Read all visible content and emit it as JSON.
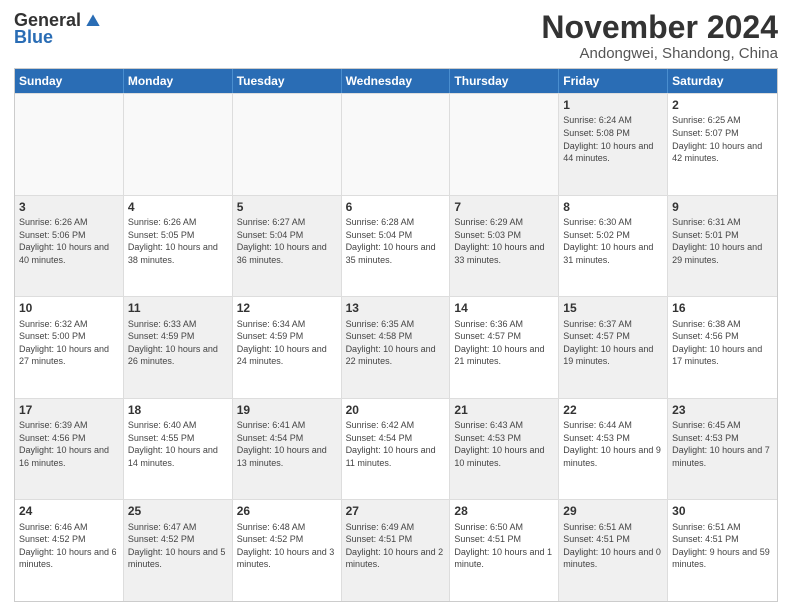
{
  "header": {
    "logo_general": "General",
    "logo_blue": "Blue",
    "month_year": "November 2024",
    "location": "Andongwei, Shandong, China"
  },
  "calendar": {
    "days": [
      "Sunday",
      "Monday",
      "Tuesday",
      "Wednesday",
      "Thursday",
      "Friday",
      "Saturday"
    ],
    "rows": [
      [
        {
          "day": "",
          "detail": "",
          "empty": true
        },
        {
          "day": "",
          "detail": "",
          "empty": true
        },
        {
          "day": "",
          "detail": "",
          "empty": true
        },
        {
          "day": "",
          "detail": "",
          "empty": true
        },
        {
          "day": "",
          "detail": "",
          "empty": true
        },
        {
          "day": "1",
          "detail": "Sunrise: 6:24 AM\nSunset: 5:08 PM\nDaylight: 10 hours and 44 minutes.",
          "shaded": true
        },
        {
          "day": "2",
          "detail": "Sunrise: 6:25 AM\nSunset: 5:07 PM\nDaylight: 10 hours and 42 minutes.",
          "shaded": false
        }
      ],
      [
        {
          "day": "3",
          "detail": "Sunrise: 6:26 AM\nSunset: 5:06 PM\nDaylight: 10 hours and 40 minutes.",
          "shaded": true
        },
        {
          "day": "4",
          "detail": "Sunrise: 6:26 AM\nSunset: 5:05 PM\nDaylight: 10 hours and 38 minutes.",
          "shaded": false
        },
        {
          "day": "5",
          "detail": "Sunrise: 6:27 AM\nSunset: 5:04 PM\nDaylight: 10 hours and 36 minutes.",
          "shaded": true
        },
        {
          "day": "6",
          "detail": "Sunrise: 6:28 AM\nSunset: 5:04 PM\nDaylight: 10 hours and 35 minutes.",
          "shaded": false
        },
        {
          "day": "7",
          "detail": "Sunrise: 6:29 AM\nSunset: 5:03 PM\nDaylight: 10 hours and 33 minutes.",
          "shaded": true
        },
        {
          "day": "8",
          "detail": "Sunrise: 6:30 AM\nSunset: 5:02 PM\nDaylight: 10 hours and 31 minutes.",
          "shaded": false
        },
        {
          "day": "9",
          "detail": "Sunrise: 6:31 AM\nSunset: 5:01 PM\nDaylight: 10 hours and 29 minutes.",
          "shaded": true
        }
      ],
      [
        {
          "day": "10",
          "detail": "Sunrise: 6:32 AM\nSunset: 5:00 PM\nDaylight: 10 hours and 27 minutes.",
          "shaded": false
        },
        {
          "day": "11",
          "detail": "Sunrise: 6:33 AM\nSunset: 4:59 PM\nDaylight: 10 hours and 26 minutes.",
          "shaded": true
        },
        {
          "day": "12",
          "detail": "Sunrise: 6:34 AM\nSunset: 4:59 PM\nDaylight: 10 hours and 24 minutes.",
          "shaded": false
        },
        {
          "day": "13",
          "detail": "Sunrise: 6:35 AM\nSunset: 4:58 PM\nDaylight: 10 hours and 22 minutes.",
          "shaded": true
        },
        {
          "day": "14",
          "detail": "Sunrise: 6:36 AM\nSunset: 4:57 PM\nDaylight: 10 hours and 21 minutes.",
          "shaded": false
        },
        {
          "day": "15",
          "detail": "Sunrise: 6:37 AM\nSunset: 4:57 PM\nDaylight: 10 hours and 19 minutes.",
          "shaded": true
        },
        {
          "day": "16",
          "detail": "Sunrise: 6:38 AM\nSunset: 4:56 PM\nDaylight: 10 hours and 17 minutes.",
          "shaded": false
        }
      ],
      [
        {
          "day": "17",
          "detail": "Sunrise: 6:39 AM\nSunset: 4:56 PM\nDaylight: 10 hours and 16 minutes.",
          "shaded": true
        },
        {
          "day": "18",
          "detail": "Sunrise: 6:40 AM\nSunset: 4:55 PM\nDaylight: 10 hours and 14 minutes.",
          "shaded": false
        },
        {
          "day": "19",
          "detail": "Sunrise: 6:41 AM\nSunset: 4:54 PM\nDaylight: 10 hours and 13 minutes.",
          "shaded": true
        },
        {
          "day": "20",
          "detail": "Sunrise: 6:42 AM\nSunset: 4:54 PM\nDaylight: 10 hours and 11 minutes.",
          "shaded": false
        },
        {
          "day": "21",
          "detail": "Sunrise: 6:43 AM\nSunset: 4:53 PM\nDaylight: 10 hours and 10 minutes.",
          "shaded": true
        },
        {
          "day": "22",
          "detail": "Sunrise: 6:44 AM\nSunset: 4:53 PM\nDaylight: 10 hours and 9 minutes.",
          "shaded": false
        },
        {
          "day": "23",
          "detail": "Sunrise: 6:45 AM\nSunset: 4:53 PM\nDaylight: 10 hours and 7 minutes.",
          "shaded": true
        }
      ],
      [
        {
          "day": "24",
          "detail": "Sunrise: 6:46 AM\nSunset: 4:52 PM\nDaylight: 10 hours and 6 minutes.",
          "shaded": false
        },
        {
          "day": "25",
          "detail": "Sunrise: 6:47 AM\nSunset: 4:52 PM\nDaylight: 10 hours and 5 minutes.",
          "shaded": true
        },
        {
          "day": "26",
          "detail": "Sunrise: 6:48 AM\nSunset: 4:52 PM\nDaylight: 10 hours and 3 minutes.",
          "shaded": false
        },
        {
          "day": "27",
          "detail": "Sunrise: 6:49 AM\nSunset: 4:51 PM\nDaylight: 10 hours and 2 minutes.",
          "shaded": true
        },
        {
          "day": "28",
          "detail": "Sunrise: 6:50 AM\nSunset: 4:51 PM\nDaylight: 10 hours and 1 minute.",
          "shaded": false
        },
        {
          "day": "29",
          "detail": "Sunrise: 6:51 AM\nSunset: 4:51 PM\nDaylight: 10 hours and 0 minutes.",
          "shaded": true
        },
        {
          "day": "30",
          "detail": "Sunrise: 6:51 AM\nSunset: 4:51 PM\nDaylight: 9 hours and 59 minutes.",
          "shaded": false
        }
      ]
    ]
  }
}
